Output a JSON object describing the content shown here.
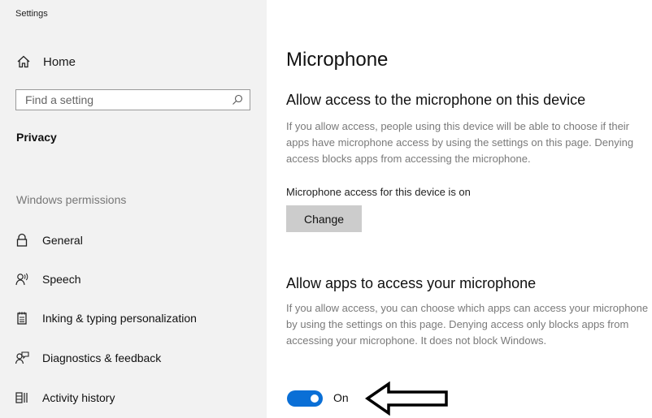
{
  "sidebar": {
    "app_title": "Settings",
    "home_label": "Home",
    "search_placeholder": "Find a setting",
    "section_title": "Privacy",
    "group_label": "Windows permissions",
    "items": [
      {
        "label": "General",
        "icon": "lock-icon"
      },
      {
        "label": "Speech",
        "icon": "speech-icon"
      },
      {
        "label": "Inking & typing personalization",
        "icon": "notepad-icon"
      },
      {
        "label": "Diagnostics & feedback",
        "icon": "feedback-icon"
      },
      {
        "label": "Activity history",
        "icon": "activity-history-icon"
      }
    ]
  },
  "main": {
    "title": "Microphone",
    "device_section": {
      "heading": "Allow access to the microphone on this device",
      "description": "If you allow access, people using this device will be able to choose if their apps have microphone access by using the settings on this page. Denying access blocks apps from accessing the microphone.",
      "status": "Microphone access for this device is on",
      "button_label": "Change"
    },
    "apps_section": {
      "heading": "Allow apps to access your microphone",
      "description": "If you allow access, you can choose which apps can access your microphone by using the settings on this page. Denying access only blocks apps from accessing your microphone. It does not block Windows.",
      "toggle_state": true,
      "toggle_label": "On"
    }
  },
  "colors": {
    "sidebar_bg": "#f2f2f2",
    "accent": "#0a6fd6",
    "button_bg": "#cccccc"
  }
}
